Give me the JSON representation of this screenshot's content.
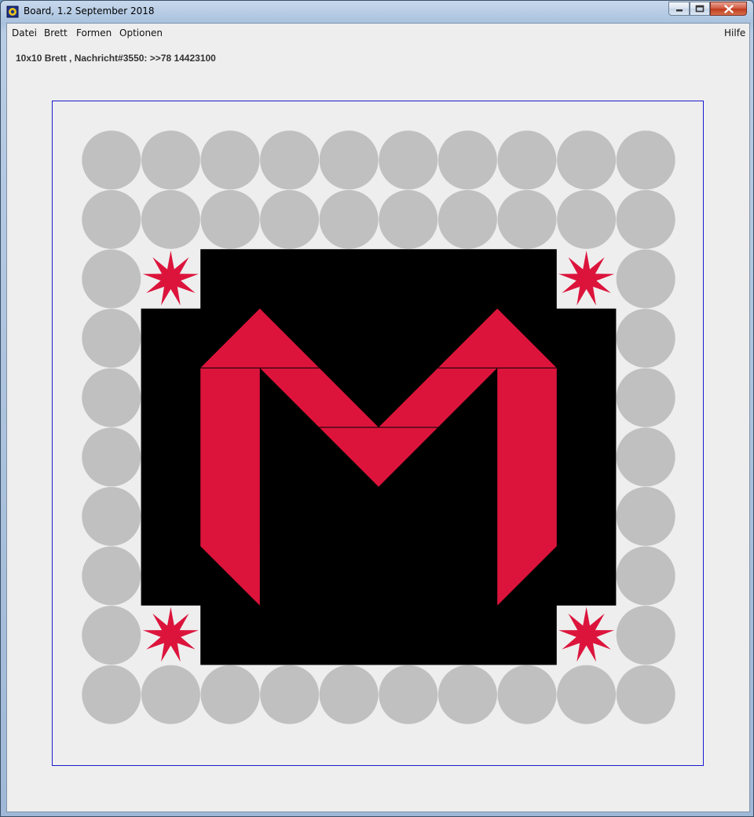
{
  "window": {
    "title": "Board, 1.2 September 2018",
    "icon": "board-app-icon"
  },
  "menubar": {
    "items": [
      "Datei",
      "Brett",
      "Formen",
      "Optionen"
    ],
    "help": "Hilfe"
  },
  "status": "10x10 Brett , Nachricht#3550: >>78 14423100",
  "board": {
    "size": [
      10,
      10
    ],
    "colors": {
      "background": "#eeeeee",
      "circle": "#c0c0c0",
      "fill": "#000000",
      "shape": "#dc143c",
      "frame": "#1a1ad0"
    },
    "stars": [
      "top-left",
      "top-right",
      "bottom-left",
      "bottom-right"
    ]
  }
}
